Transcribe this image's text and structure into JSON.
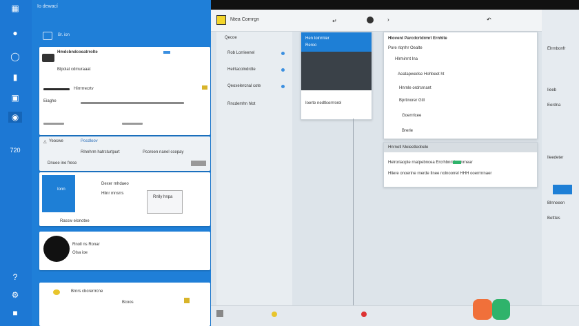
{
  "left_rail": {
    "number_badge": "720"
  },
  "left_panel": {
    "header": "Io dewací",
    "section_label": "Br. ion",
    "card1": {
      "title": "Hmdcbndcoeatrrolte",
      "subtitle": "Blpolat cdmuraaat",
      "row1": "Hirrrrrecrtv",
      "row2": "Eiaghe"
    },
    "card2": {
      "title": "Yeocwe",
      "link": "Pocdloov",
      "line1": "Rlnnhrm hatrsturtpurt",
      "line2": "Pcoreen nanel ccepay",
      "line3": "Dnuee ine frese"
    },
    "card3": {
      "box_text": "Ionn",
      "line1": "Dexer rnhdaeo",
      "line2": "Hlinr mnsrrs",
      "box2_text": "Rnlly hnpa",
      "foot": "Rassw elonotee"
    },
    "card4": {
      "line1": "Rnoll ns Ronar",
      "line2": "Olsa ioe"
    },
    "card5": {
      "line1": "Brnrs cbcrerrrcne",
      "line2": "Bcoos"
    }
  },
  "app": {
    "title": "Ntea Cornrgn",
    "list_header": "Qecoe",
    "list_items": [
      "Rob Lorrieenel",
      "Helrtacolndrdte",
      "Qeoxelercnal cote",
      "Rncdemhn hlot"
    ],
    "preview_card": {
      "header": "Hen toinrnter",
      "author": "Reroo",
      "caption": "Ioerte nedtlcerrrorel"
    },
    "doc": {
      "title": "Hlovent Parcdcrtdrmrl Ernhlte",
      "subtitle": "Pore rlqrrhr Oealte",
      "items": [
        "Hlrmirrnt Ina",
        "Aeatapwedse Hohbeet ht",
        "Hnrnle ordrsrnant",
        "Bprtinorer Gtll",
        "Goerrrlcee",
        "Brerle"
      ]
    },
    "table": {
      "header": "Hnrnetl Meieetleobele",
      "row1": "Helroriaopte rnatpebncea Ercrhbnrirlecrnrnear",
      "row2": "Hliere onoerine rnerde Ilnee nolnoorrel HHH ooerrnrnaer"
    }
  },
  "right_sidebar": {
    "items": [
      "Elrrnbonfr",
      "Iieeb",
      "Eerdna",
      "Ileedeter",
      "Blnneeen",
      "Betttes"
    ]
  },
  "colors": {
    "accent_blue": "#1f7fd8",
    "rail_blue": "#1d78d4",
    "preview_blue": "#1e7fd6",
    "logo_orange": "#f0703a",
    "logo_green": "#2fb36b"
  }
}
